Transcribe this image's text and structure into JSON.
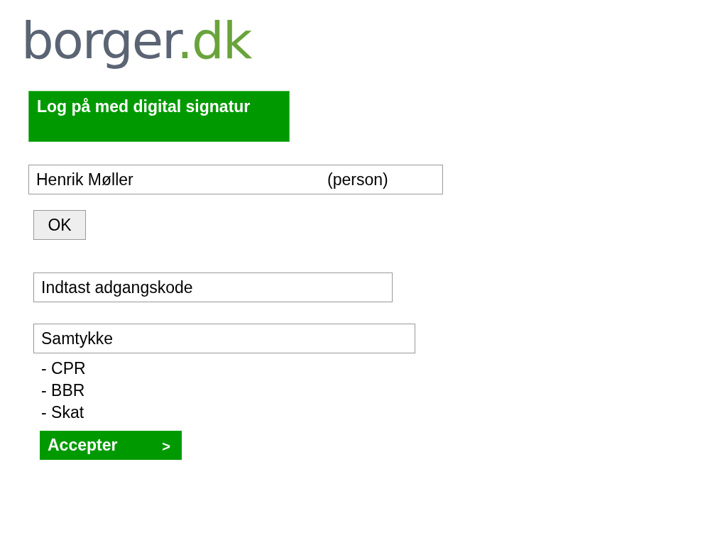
{
  "logo": {
    "name": "borger",
    "suffix": ".dk"
  },
  "login_panel": {
    "title": "Log på med digital signatur"
  },
  "identity_field": {
    "value": "Henrik Møller",
    "type": "(person)"
  },
  "ok_button": {
    "label": "OK"
  },
  "password_field": {
    "placeholder": "Indtast adgangskode"
  },
  "consent_field": {
    "value": "Samtykke"
  },
  "consent_items": [
    "- CPR",
    "- BBR",
    "- Skat"
  ],
  "accept_button": {
    "label": "Accepter",
    "arrow": ">"
  }
}
